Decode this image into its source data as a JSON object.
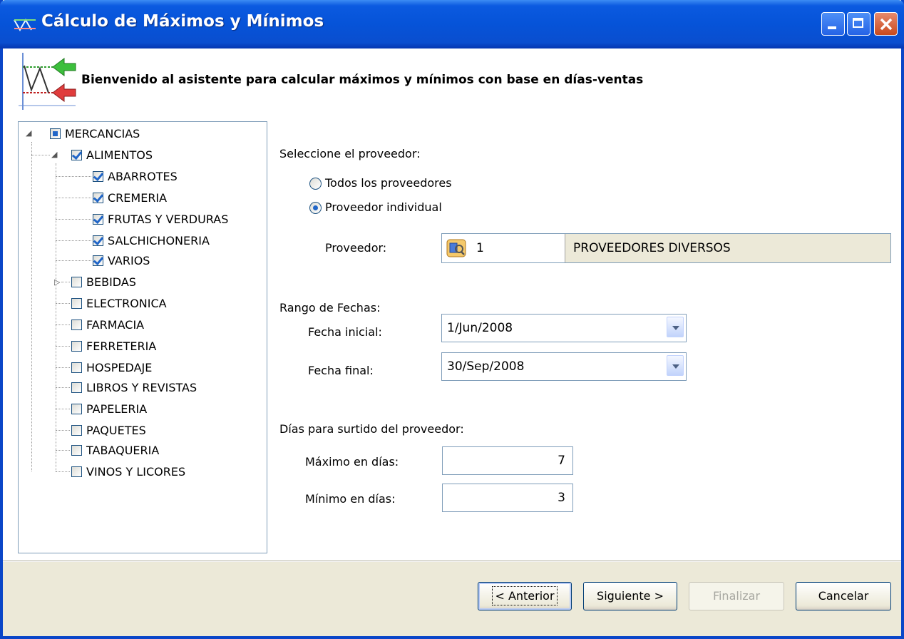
{
  "window": {
    "title": "Cálculo de Máximos y Mínimos",
    "colors": {
      "titlebar": "#0653d8",
      "close": "#c84a1e",
      "background": "#ece9d8"
    }
  },
  "header": {
    "text": "Bienvenido al asistente para calcular máximos y mínimos con base en días-ventas",
    "icon": "min-max-chart-icon"
  },
  "tree": {
    "root": {
      "label": "MERCANCIAS",
      "state": "partial",
      "expanded": true
    },
    "alimentos": {
      "label": "ALIMENTOS",
      "state": "checked",
      "expanded": true
    },
    "alimentos_children": [
      {
        "label": "ABARROTES",
        "state": "checked"
      },
      {
        "label": "CREMERIA",
        "state": "checked"
      },
      {
        "label": "FRUTAS Y VERDURAS",
        "state": "checked"
      },
      {
        "label": "SALCHICHONERIA",
        "state": "checked"
      },
      {
        "label": "VARIOS",
        "state": "checked"
      }
    ],
    "others": [
      {
        "label": "BEBIDAS",
        "state": "unchecked",
        "collapsed": true
      },
      {
        "label": "ELECTRONICA",
        "state": "unchecked"
      },
      {
        "label": "FARMACIA",
        "state": "unchecked"
      },
      {
        "label": "FERRETERIA",
        "state": "unchecked"
      },
      {
        "label": "HOSPEDAJE",
        "state": "unchecked"
      },
      {
        "label": "LIBROS Y REVISTAS",
        "state": "unchecked"
      },
      {
        "label": "PAPELERIA",
        "state": "unchecked"
      },
      {
        "label": "PAQUETES",
        "state": "unchecked"
      },
      {
        "label": "TABAQUERIA",
        "state": "unchecked"
      },
      {
        "label": "VINOS Y LICORES",
        "state": "unchecked"
      }
    ]
  },
  "supplier": {
    "heading": "Seleccione el proveedor:",
    "option_all": "Todos los proveedores",
    "option_single": "Proveedor individual",
    "selected": "single",
    "field_label": "Proveedor:",
    "code": "1",
    "name": "PROVEEDORES DIVERSOS"
  },
  "dates": {
    "heading": "Rango de Fechas:",
    "start_label": "Fecha inicial:",
    "start_value": "1/Jun/2008",
    "end_label": "Fecha final:",
    "end_value": "30/Sep/2008"
  },
  "days": {
    "heading": "Días para surtido del proveedor:",
    "max_label": "Máximo en días:",
    "max_value": "7",
    "min_label": "Mínimo en días:",
    "min_value": "3"
  },
  "buttons": {
    "back": "< Anterior",
    "next": "Siguiente >",
    "finish": "Finalizar",
    "cancel": "Cancelar"
  }
}
